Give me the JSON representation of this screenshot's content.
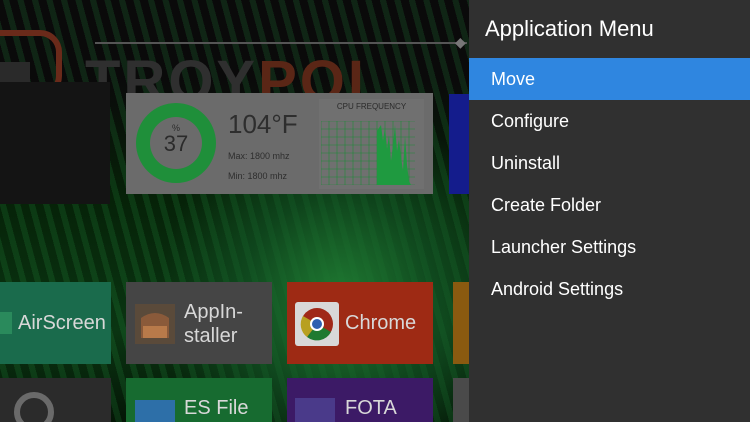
{
  "launcher": {
    "brand": {
      "part1": "TROY",
      "part2": "POI"
    },
    "system_widget": {
      "gauge_unit": "%",
      "gauge_value": "37",
      "temperature": "104°F",
      "max_freq": "Max:  1800 mhz",
      "min_freq": "Min:   1800 mhz",
      "cpu_title": "CPU FREQUENCY"
    },
    "tiles": [
      {
        "label": "AirScreen",
        "icon": "airscreen-icon",
        "color": "#1a6b4c"
      },
      {
        "label_line1": "AppIn-",
        "label_line2": "staller",
        "icon": "appinstaller-icon",
        "color": "#454545"
      },
      {
        "label": "Chrome",
        "icon": "chrome-icon",
        "color": "#9e2a14"
      },
      {
        "label": "ES File",
        "icon": "es-file-icon",
        "color": "#176b30"
      },
      {
        "label": "FOTA",
        "icon": "fota-icon",
        "color": "#3c1a66"
      }
    ]
  },
  "menu": {
    "title": "Application Menu",
    "items": [
      {
        "label": "Move",
        "selected": true
      },
      {
        "label": "Configure",
        "selected": false
      },
      {
        "label": "Uninstall",
        "selected": false
      },
      {
        "label": "Create Folder",
        "selected": false
      },
      {
        "label": "Launcher Settings",
        "selected": false
      },
      {
        "label": "Android Settings",
        "selected": false
      }
    ],
    "accent_color": "#2f86e0"
  }
}
